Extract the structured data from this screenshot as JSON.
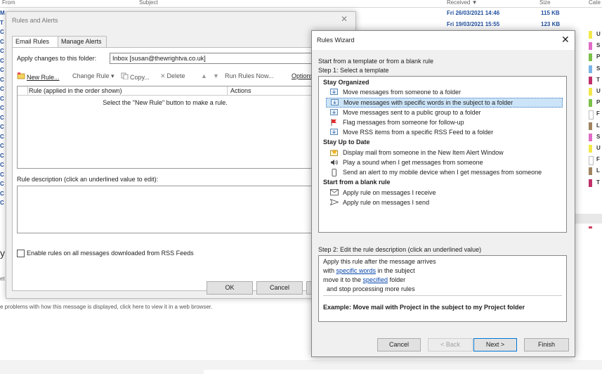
{
  "background": {
    "header": {
      "from": "From",
      "subject": "Subject",
      "received": "Received ▼",
      "size": "Size",
      "categories": "Cate"
    },
    "rows": [
      {
        "received": "Fri 26/03/2021 14:46",
        "size": "115 KB"
      },
      {
        "received": "Fri 19/03/2021 15:55",
        "size": "123 KB"
      }
    ],
    "categories": [
      {
        "label": "U",
        "color": "#f2e84b"
      },
      {
        "label": "S",
        "color": "#e06cc6"
      },
      {
        "label": "P",
        "color": "#7ac04b"
      },
      {
        "label": "S",
        "color": "#7ab4e8"
      },
      {
        "label": "T",
        "color": "#c0306a"
      },
      {
        "label": "U",
        "color": "#f2e84b"
      },
      {
        "label": "P",
        "color": "#7ac04b"
      },
      {
        "label": "F",
        "color": "#ffffff"
      },
      {
        "label": "L",
        "color": "#a08460"
      },
      {
        "label": "S",
        "color": "#e06cc6"
      },
      {
        "label": "U",
        "color": "#f2e84b"
      },
      {
        "label": "F",
        "color": "#ffffff"
      },
      {
        "label": "L",
        "color": "#a08460"
      },
      {
        "label": "T",
        "color": "#c0306a"
      }
    ],
    "left_fragments": [
      "M",
      "T",
      "C",
      "C",
      "C",
      "C",
      "C",
      "C",
      "C",
      "C",
      "C",
      "C",
      "C",
      "C",
      "C",
      "C",
      "C",
      "C",
      "C",
      "C",
      "C"
    ],
    "frag_y": "y",
    "frag_et": "et",
    "frag_problems": "e problems with how this message is displayed, click here to view it in a web browser."
  },
  "rules_alerts": {
    "title": "Rules and Alerts",
    "close": "✕",
    "tabs": [
      "Email Rules",
      "Manage Alerts"
    ],
    "apply_label": "Apply changes to this folder:",
    "apply_value": "Inbox [susan@thewrightva.co.uk]",
    "toolbar": {
      "new_rule": "New Rule...",
      "change_rule": "Change Rule ▾",
      "copy": "Copy...",
      "delete": "Delete",
      "run_rules": "Run Rules Now...",
      "options": "Options"
    },
    "table": {
      "col1": "Rule (applied in the order shown)",
      "col2": "Actions",
      "empty": "Select the \"New Rule\" button to make a rule."
    },
    "desc_label": "Rule description (click an underlined value to edit):",
    "rss_label": "Enable rules on all messages downloaded from RSS Feeds",
    "ok": "OK",
    "cancel": "Cancel"
  },
  "wizard": {
    "title": "Rules Wizard",
    "close": "✕",
    "intro": "Start from a template or from a blank rule",
    "step1": "Step 1: Select a template",
    "groups": [
      {
        "name": "Stay Organized",
        "items": [
          {
            "label": "Move messages from someone to a folder",
            "icon": "folder-move-icon"
          },
          {
            "label": "Move messages with specific words in the subject to a folder",
            "icon": "folder-move-icon",
            "selected": true
          },
          {
            "label": "Move messages sent to a public group to a folder",
            "icon": "folder-move-icon"
          },
          {
            "label": "Flag messages from someone for follow-up",
            "icon": "flag-icon"
          },
          {
            "label": "Move RSS items from a specific RSS Feed to a folder",
            "icon": "folder-move-icon"
          }
        ]
      },
      {
        "name": "Stay Up to Date",
        "items": [
          {
            "label": "Display mail from someone in the New Item Alert Window",
            "icon": "alert-icon"
          },
          {
            "label": "Play a sound when I get messages from someone",
            "icon": "speaker-icon"
          },
          {
            "label": "Send an alert to my mobile device when I get messages from someone",
            "icon": "mobile-icon"
          }
        ]
      },
      {
        "name": "Start from a blank rule",
        "items": [
          {
            "label": "Apply rule on messages I receive",
            "icon": "envelope-icon"
          },
          {
            "label": "Apply rule on messages I send",
            "icon": "send-icon"
          }
        ]
      }
    ],
    "step2": "Step 2: Edit the rule description (click an underlined value)",
    "desc": {
      "line1": "Apply this rule after the message arrives",
      "line2_pre": "with ",
      "line2_link": "specific words",
      "line2_post": " in the subject",
      "line3_pre": "move it to the ",
      "line3_link": "specified",
      "line3_post": " folder",
      "line4": "  and stop processing more rules",
      "example": "Example: Move mail with Project in the subject to my Project folder"
    },
    "buttons": {
      "cancel": "Cancel",
      "back": "< Back",
      "next": "Next >",
      "finish": "Finish"
    }
  }
}
